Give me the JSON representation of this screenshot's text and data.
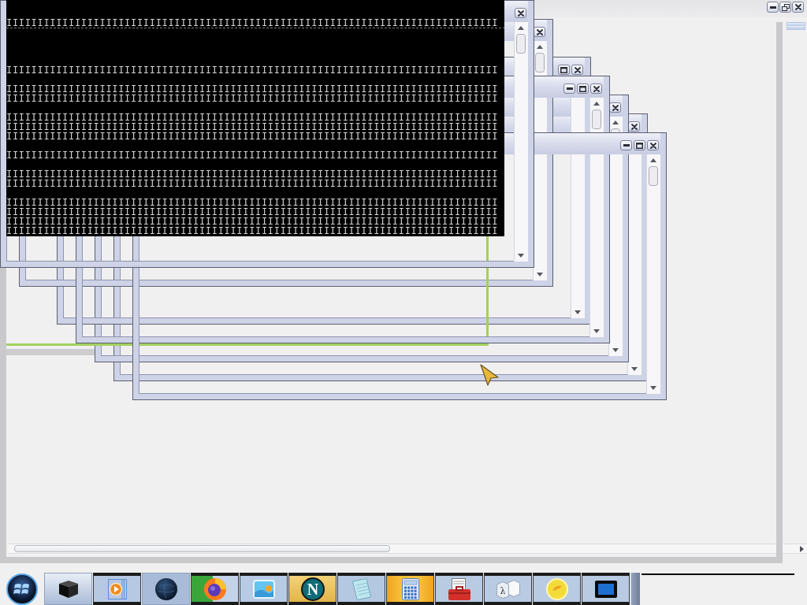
{
  "background_window": {
    "caption_buttons": [
      {
        "kind": "minimize"
      },
      {
        "kind": "restore"
      },
      {
        "kind": "close"
      }
    ]
  },
  "windows": [
    {
      "kind": "terminal",
      "caption_buttons": [
        {
          "kind": "close"
        }
      ],
      "lines": [
        {
          "kind": "blank"
        },
        {
          "kind": "blank"
        },
        {
          "kind": "ruled",
          "text": "IIIIIIIIIIIIIIIIIIIIIIIIIIIIIIIIIIIIIIIIIIIIIIIIIIIIIIIIIIIIIIIIIIIIIIIIIIIIIII"
        },
        {
          "kind": "blank"
        },
        {
          "kind": "blank"
        },
        {
          "kind": "blank"
        },
        {
          "kind": "blank"
        },
        {
          "kind": "text",
          "text": "IIIIIIIIIIIIIIIIIIIIIIIIIIIIIIIIIIIIIIIIIIIIIIIIIIIIIIIIIIIIIIIIIIIIIIIIIIIIIII"
        },
        {
          "kind": "blank"
        },
        {
          "kind": "text",
          "text": "IIIIIIIIIIIIIIIIIIIIIIIIIIIIIIIIIIIIIIIIIIIIIIIIIIIIIIIIIIIIIIIIIIIIIIIIIIIIIII"
        },
        {
          "kind": "text",
          "text": "IIIIIIIIIIIIIIIIIIIIIIIIIIIIIIIIIIIIIIIIIIIIIIIIIIIIIIIIIIIIIIIIIIIIIIIIIIIIIII"
        },
        {
          "kind": "blank"
        },
        {
          "kind": "text",
          "text": "IIIIIIIIIIIIIIIIIIIIIIIIIIIIIIIIIIIIIIIIIIIIIIIIIIIIIIIIIIIIIIIIIIIIIIIIIIIIIII"
        },
        {
          "kind": "text",
          "text": "IIIIIIIIIIIIIIIIIIIIIIIIIIIIIIIIIIIIIIIIIIIIIIIIIIIIIIIIIIIIIIIIIIIIIIIIIIIIIII"
        },
        {
          "kind": "text",
          "text": "IIIIIIIIIIIIIIIIIIIIIIIIIIIIIIIIIIIIIIIIIIIIIIIIIIIIIIIIIIIIIIIIIIIIIIIIIIIIIII"
        },
        {
          "kind": "blank"
        },
        {
          "kind": "text",
          "text": "IIIIIIIIIIIIIIIIIIIIIIIIIIIIIIIIIIIIIIIIIIIIIIIIIIIIIIIIIIIIIIIIIIIIIIIIIIIIIII"
        },
        {
          "kind": "blank"
        },
        {
          "kind": "text",
          "text": "IIIIIIIIIIIIIIIIIIIIIIIIIIIIIIIIIIIIIIIIIIIIIIIIIIIIIIIIIIIIIIIIIIIIIIIIIIIIIII"
        },
        {
          "kind": "text",
          "text": "IIIIIIIIIIIIIIIIIIIIIIIIIIIIIIIIIIIIIIIIIIIIIIIIIIIIIIIIIIIIIIIIIIIIIIIIIIIIIII"
        },
        {
          "kind": "blank"
        },
        {
          "kind": "text",
          "text": "IIIIIIIIIIIIIIIIIIIIIIIIIIIIIIIIIIIIIIIIIIIIIIIIIIIIIIIIIIIIIIIIIIIIIIIIIIIIIII"
        },
        {
          "kind": "text",
          "text": "IIIIIIIIIIIIIIIIIIIIIIIIIIIIIIIIIIIIIIIIIIIIIIIIIIIIIIIIIIIIIIIIIIIIIIIIIIIIIII"
        },
        {
          "kind": "text",
          "text": "IIIIIIIIIIIIIIIIIIIIIIIIIIIIIIIIIIIIIIIIIIIIIIIIIIIIIIIIIIIIIIIIIIIIIIIIIIIIIII"
        },
        {
          "kind": "text",
          "text": "IIIIIIIIIIIIIIIIIIIIIIIIIIIIIIIIIIIIIIIIIIIIIIIIIIIIIIIIIIIIIIIIIIIIIIIIIIIIIII"
        }
      ]
    },
    {
      "kind": "empty",
      "caption_buttons": [
        {
          "kind": "close"
        }
      ]
    },
    {
      "kind": "empty",
      "caption_buttons": [
        {
          "kind": "maximize"
        },
        {
          "kind": "close"
        }
      ]
    },
    {
      "kind": "empty",
      "caption_buttons": [
        {
          "kind": "minimize"
        },
        {
          "kind": "maximize"
        },
        {
          "kind": "close"
        }
      ]
    },
    {
      "kind": "empty",
      "caption_buttons": [
        {
          "kind": "close"
        }
      ]
    },
    {
      "kind": "empty",
      "caption_buttons": [
        {
          "kind": "close"
        }
      ]
    },
    {
      "kind": "empty",
      "caption_buttons": [
        {
          "kind": "minimize"
        },
        {
          "kind": "maximize"
        },
        {
          "kind": "close"
        }
      ]
    }
  ],
  "taskbar": {
    "buttons": [
      {
        "kind": "box",
        "selected": true
      },
      {
        "kind": "media",
        "selected": false
      },
      {
        "kind": "globe",
        "selected": true
      },
      {
        "kind": "browser",
        "selected": false
      },
      {
        "kind": "pictures",
        "selected": false
      },
      {
        "kind": "letter",
        "glyph": "N",
        "selected": false
      },
      {
        "kind": "notepad",
        "selected": false
      },
      {
        "kind": "calculator",
        "selected": false
      },
      {
        "kind": "toolbox",
        "selected": false
      },
      {
        "kind": "cubes",
        "glyph": "λ",
        "selected": false
      },
      {
        "kind": "disc",
        "selected": false
      },
      {
        "kind": "monitor",
        "selected": false
      }
    ]
  }
}
